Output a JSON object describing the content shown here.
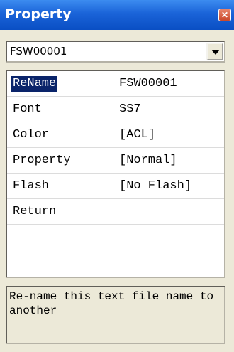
{
  "window": {
    "title": "Property",
    "close_glyph": "✕"
  },
  "selector": {
    "value": "FSW00001"
  },
  "properties": [
    {
      "key": "ReName",
      "value": "FSW00001"
    },
    {
      "key": "Font",
      "value": "SS7"
    },
    {
      "key": "Color",
      "value": "[ACL]"
    },
    {
      "key": "Property",
      "value": "[Normal]"
    },
    {
      "key": "Flash",
      "value": "[No Flash]"
    },
    {
      "key": "Return",
      "value": ""
    }
  ],
  "description": "Re-name this text file name to another",
  "colors": {
    "titlebar": "#1a63d8",
    "selection": "#0a246a",
    "face": "#ece9d8"
  }
}
